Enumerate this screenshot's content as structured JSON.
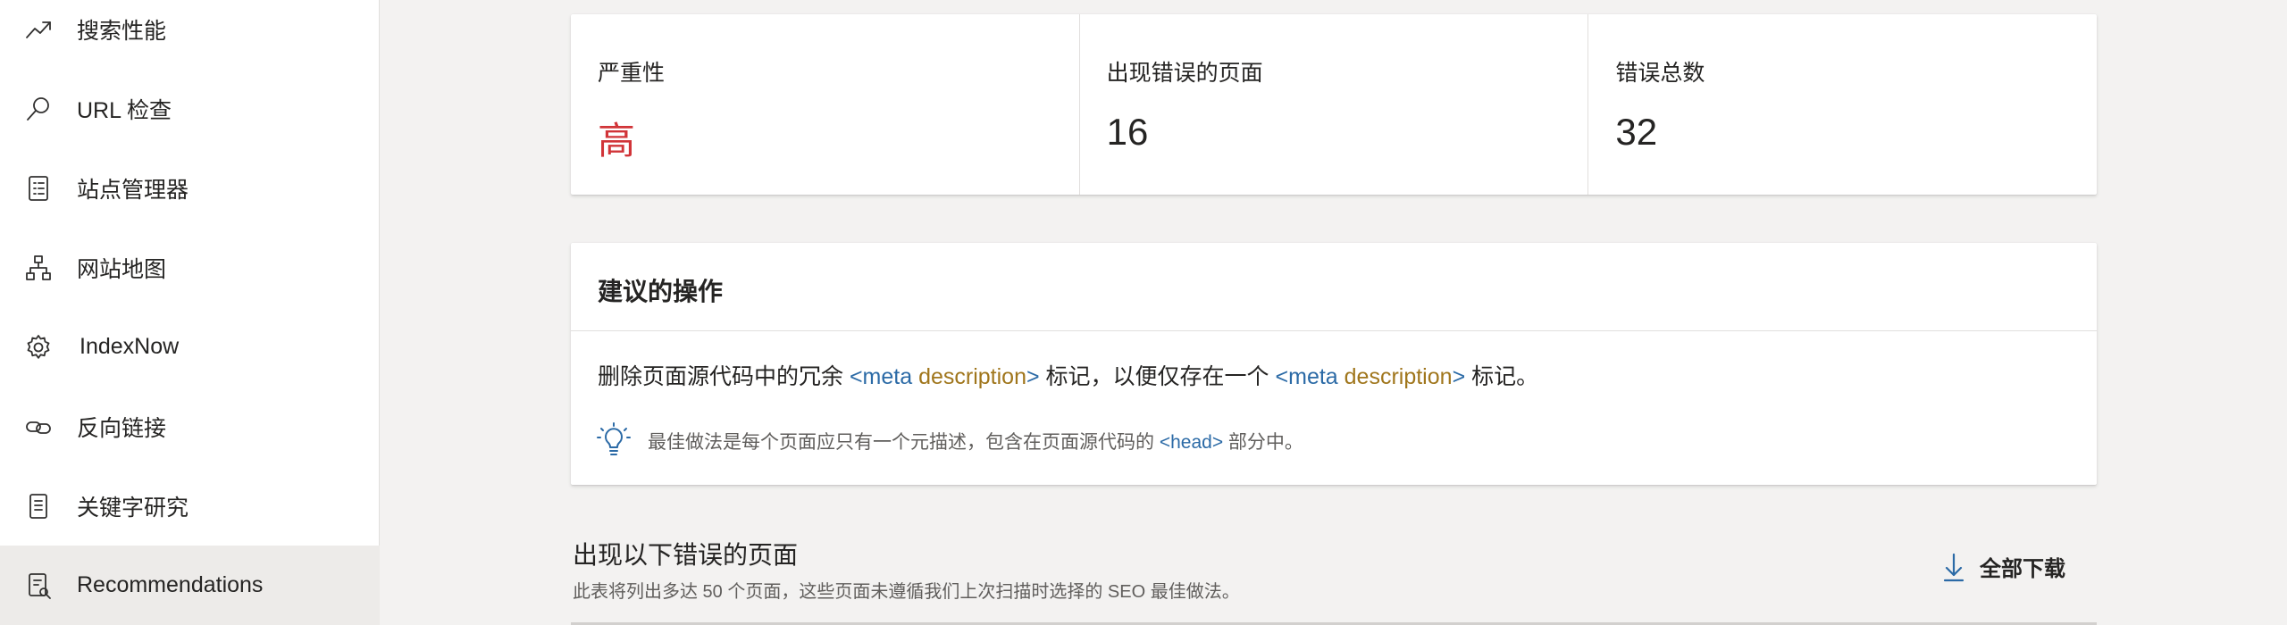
{
  "sidebar": {
    "items": [
      {
        "label": "搜索性能",
        "icon": "trend-line-icon"
      },
      {
        "label": "URL 检查",
        "icon": "search-icon"
      },
      {
        "label": "站点管理器",
        "icon": "checklist-icon"
      },
      {
        "label": "网站地图",
        "icon": "sitemap-icon"
      },
      {
        "label": "IndexNow",
        "icon": "gear-icon"
      },
      {
        "label": "反向链接",
        "icon": "link-icon"
      },
      {
        "label": "关键字研究",
        "icon": "document-list-icon"
      },
      {
        "label": "Recommendations",
        "icon": "recommendations-icon",
        "active": true
      }
    ]
  },
  "stats": {
    "severity": {
      "label": "严重性",
      "value": "高"
    },
    "pages": {
      "label": "出现错误的页面",
      "value": "16"
    },
    "total": {
      "label": "错误总数",
      "value": "32"
    }
  },
  "actions": {
    "title": "建议的操作",
    "text_prefix": "删除页面源代码中的冗余 ",
    "tag_open": "<meta",
    "attr": " description",
    "tag_close": ">",
    "text_middle": " 标记，以便仅存在一个 ",
    "text_suffix": " 标记。",
    "tip_prefix": "最佳做法是每个页面应只有一个元描述，包含在页面源代码的 ",
    "tip_tag": "<head>",
    "tip_suffix": " 部分中。"
  },
  "pages_section": {
    "title": "出现以下错误的页面",
    "subtitle": "此表将列出多达 50 个页面，这些页面未遵循我们上次扫描时选择的 SEO 最佳做法。",
    "download_label": "全部下载"
  },
  "colors": {
    "severity_high": "#d13438",
    "tag": "#2b6aa6",
    "attr": "#a0761c"
  }
}
